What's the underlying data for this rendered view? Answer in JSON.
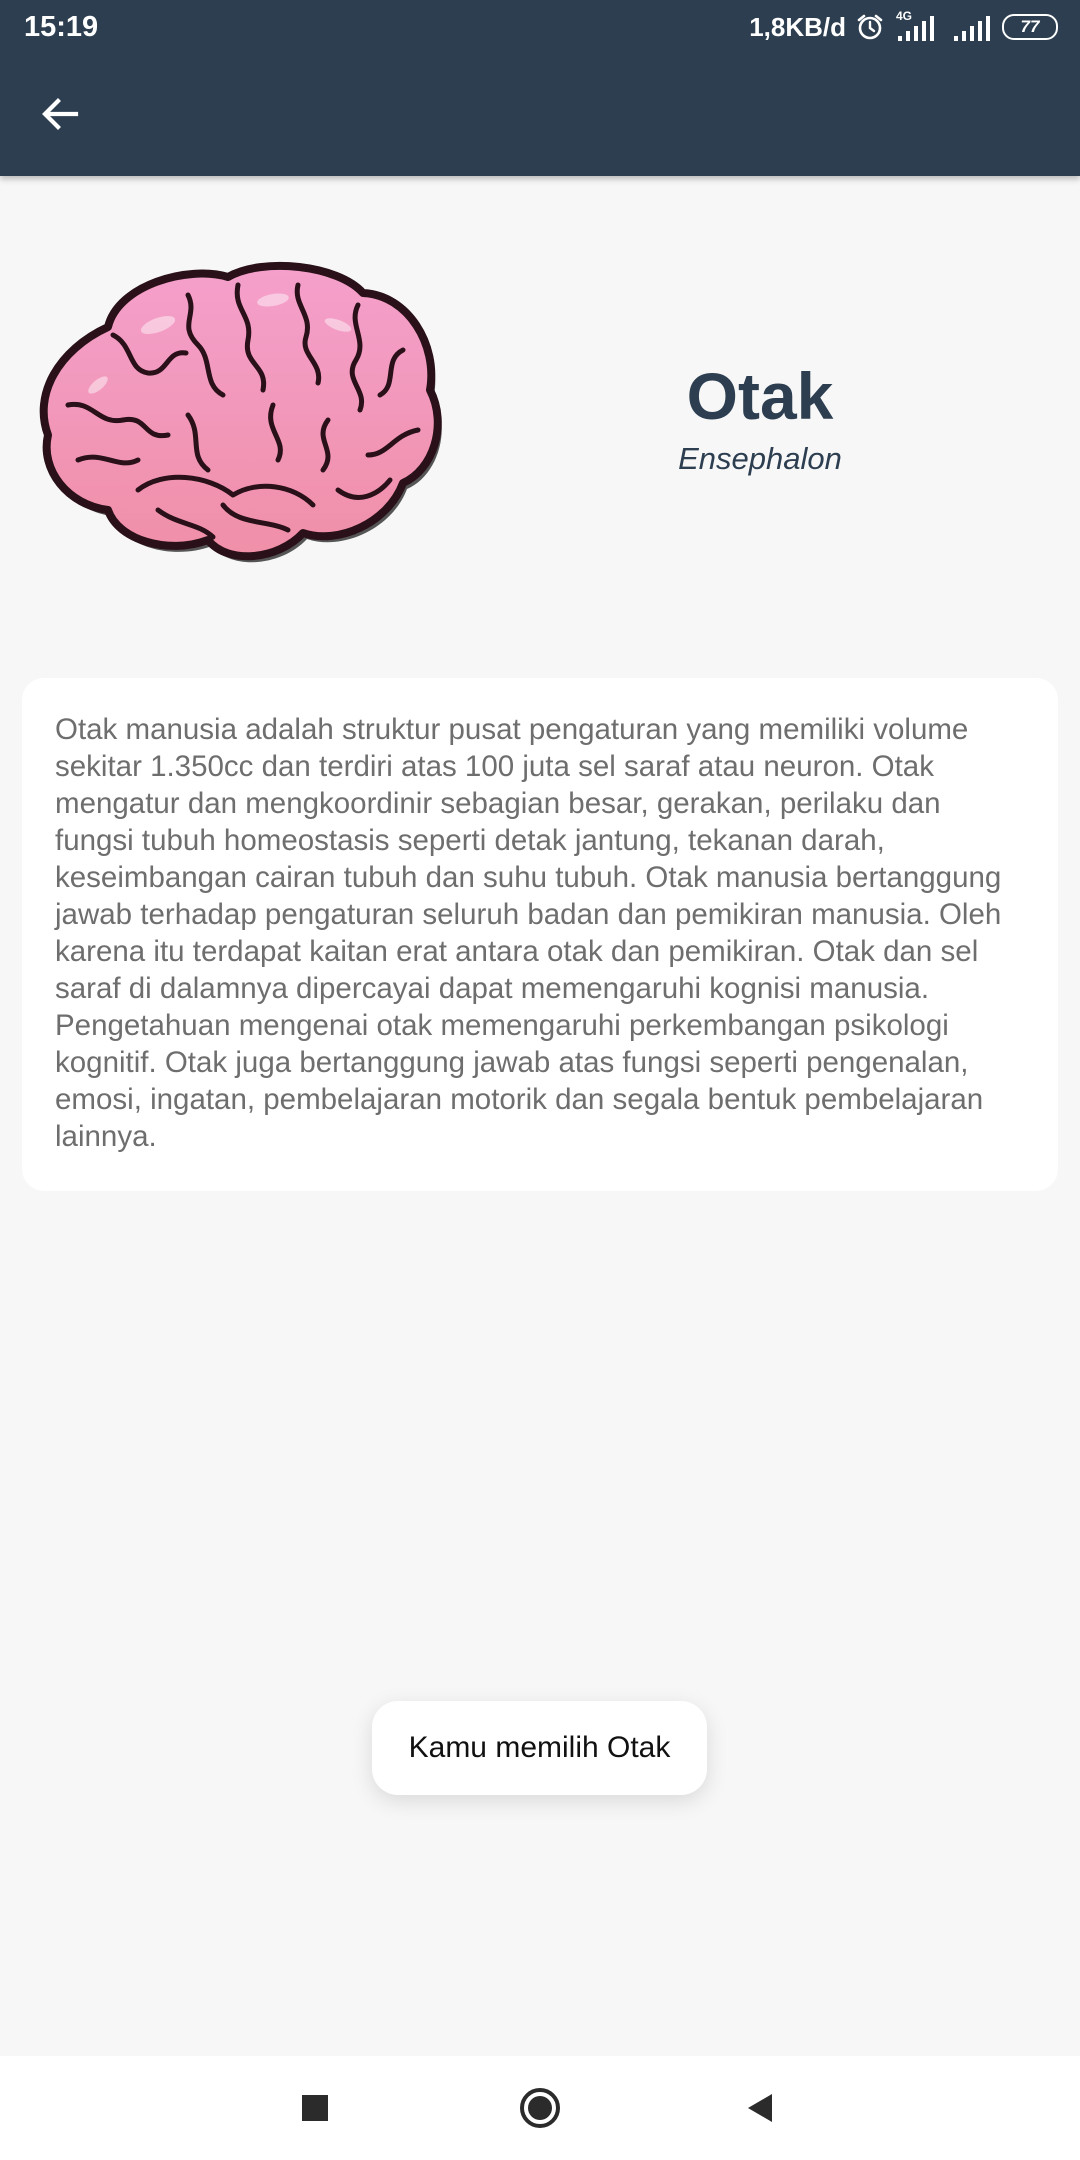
{
  "status_bar": {
    "time": "15:19",
    "net_speed": "1,8KB/d",
    "network_type": "4G",
    "battery_level": "77",
    "icons": [
      "alarm-icon",
      "signal-icon",
      "signal-icon",
      "battery-icon"
    ]
  },
  "app_bar": {
    "back_icon": "arrow-left-icon"
  },
  "organ": {
    "name": "Otak",
    "latin_name": "Ensephalon",
    "image": "brain-illustration",
    "description": "Otak manusia adalah struktur pusat pengaturan yang memiliki volume sekitar 1.350cc dan terdiri atas 100 juta sel saraf atau neuron. Otak mengatur dan mengkoordinir sebagian besar, gerakan, perilaku dan fungsi tubuh homeostasis seperti detak jantung, tekanan darah, keseimbangan cairan tubuh dan suhu tubuh. Otak manusia bertanggung jawab terhadap pengaturan seluruh badan dan pemikiran manusia. Oleh karena itu terdapat kaitan erat antara otak dan pemikiran. Otak dan sel saraf di dalamnya dipercayai dapat memengaruhi kognisi manusia. Pengetahuan mengenai otak memengaruhi perkembangan psikologi kognitif. Otak juga bertanggung jawab atas fungsi seperti pengenalan, emosi, ingatan, pembelajaran motorik dan segala bentuk pembelajaran lainnya."
  },
  "toast": {
    "message": "Kamu memilih Otak"
  },
  "nav_bar": {
    "icons": [
      "recents-square-icon",
      "home-circle-icon",
      "back-triangle-icon"
    ]
  },
  "colors": {
    "primary": "#2c3e50",
    "background": "#f7f7f7",
    "card": "#ffffff",
    "body_text": "#6e6e6e",
    "brain_pink": "#f39ac4"
  }
}
